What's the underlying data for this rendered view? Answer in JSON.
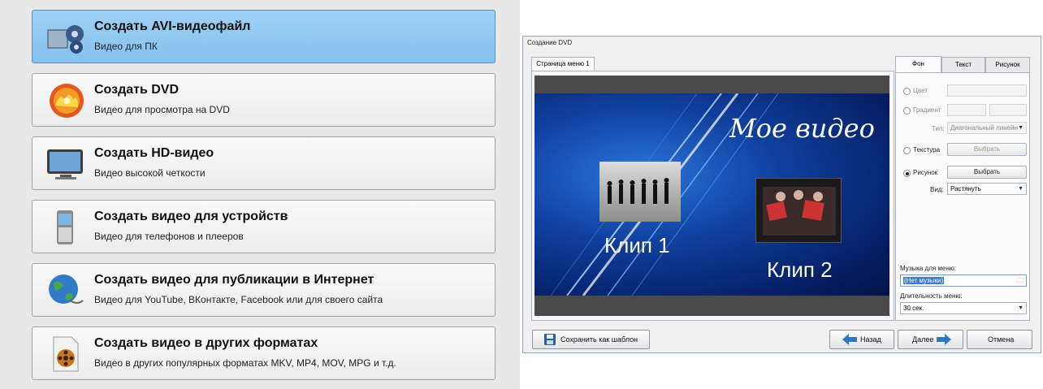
{
  "options": [
    {
      "title": "Создать AVI-видеофайл",
      "subtitle": "Видео для ПК",
      "icon": "film-reel-icon",
      "selected": true
    },
    {
      "title": "Создать DVD",
      "subtitle": "Видео для просмотра на DVD",
      "icon": "dvd-disc-icon",
      "selected": false
    },
    {
      "title": "Создать HD-видео",
      "subtitle": "Видео высокой четкости",
      "icon": "monitor-icon",
      "selected": false
    },
    {
      "title": "Создать видео для устройств",
      "subtitle": "Видео для телефонов и плееров",
      "icon": "phone-icon",
      "selected": false
    },
    {
      "title": "Создать видео для публикации в Интернет",
      "subtitle": "Видео для YouTube, ВКонтакте, Facebook или для своего сайта",
      "icon": "globe-icon",
      "selected": false
    },
    {
      "title": "Создать видео в других форматах",
      "subtitle": "Видео в других популярных форматах MKV, MP4, MOV, MPG и т.д.",
      "icon": "video-file-icon",
      "selected": false
    }
  ],
  "dialog": {
    "title": "Создание DVD",
    "page_tab": "Страница меню 1",
    "preview": {
      "heading": "Мое видео",
      "clip1": "Клип 1",
      "clip2": "Клип 2"
    },
    "tabs": [
      "Фон",
      "Текст",
      "Рисунок"
    ],
    "bg": {
      "color_label": "Цвет",
      "gradient_label": "Градиент",
      "type_label": "Тип:",
      "type_value": "Диагональный линейн",
      "texture_label": "Текстура",
      "texture_button": "Выбрать",
      "picture_label": "Рисунок",
      "picture_button": "Выбрать",
      "view_label": "Вид:",
      "view_value": "Растянуть",
      "selected": "Рисунок"
    },
    "music_label": "Музыка для меню:",
    "music_value": "(Нет музыки)",
    "duration_label": "Длительность меню:",
    "duration_value": "30 сек.",
    "buttons": {
      "save_template": "Сохранить как шаблон",
      "back": "Назад",
      "next": "Далее",
      "cancel": "Отмена"
    }
  }
}
